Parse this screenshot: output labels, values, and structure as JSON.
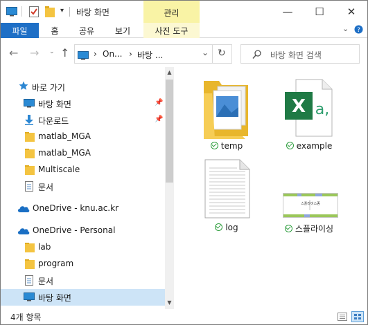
{
  "titlebar": {
    "title": "바탕 화면",
    "context_tab": "관리",
    "minimize": "—",
    "maximize": "☐",
    "close": "✕"
  },
  "ribbon": {
    "tabs": [
      "파일",
      "홈",
      "공유",
      "보기",
      "사진 도구"
    ]
  },
  "address": {
    "crumbs": [
      "On...",
      "바탕 ..."
    ],
    "search_placeholder": "바탕 화면 검색"
  },
  "nav": {
    "items": [
      {
        "label": "바로 가기",
        "icon": "star-icon"
      },
      {
        "label": "바탕 화면",
        "icon": "desktop-icon"
      },
      {
        "label": "다운로드",
        "icon": "download-icon"
      },
      {
        "label": "matlab_MGA",
        "icon": "folder-icon"
      },
      {
        "label": "matlab_MGA",
        "icon": "folder-icon"
      },
      {
        "label": "Multiscale",
        "icon": "folder-icon"
      },
      {
        "label": "문서",
        "icon": "document-icon"
      },
      {
        "label": "OneDrive - knu.ac.kr",
        "icon": "cloud-icon"
      },
      {
        "label": "OneDrive - Personal",
        "icon": "cloud-icon"
      },
      {
        "label": "lab",
        "icon": "folder-icon"
      },
      {
        "label": "program",
        "icon": "folder-icon"
      },
      {
        "label": "문서",
        "icon": "document-icon"
      },
      {
        "label": "바탕 화면",
        "icon": "desktop-icon"
      }
    ]
  },
  "files": [
    {
      "name": "temp",
      "icon": "folder-with-images-icon"
    },
    {
      "name": "example",
      "icon": "excel-file-icon"
    },
    {
      "name": "log",
      "icon": "text-file-icon"
    },
    {
      "name": "스플라이싱",
      "icon": "image-thumbnail-icon",
      "thumb_text": "스플라이스종"
    }
  ],
  "status": {
    "count": "4개 항목"
  },
  "colors": {
    "file_tab": "#1e6fc6",
    "context_tab": "#f9f3a5",
    "selected": "#cde4f7",
    "sync_check": "#2e9e3e",
    "excel": "#1f7a45"
  }
}
